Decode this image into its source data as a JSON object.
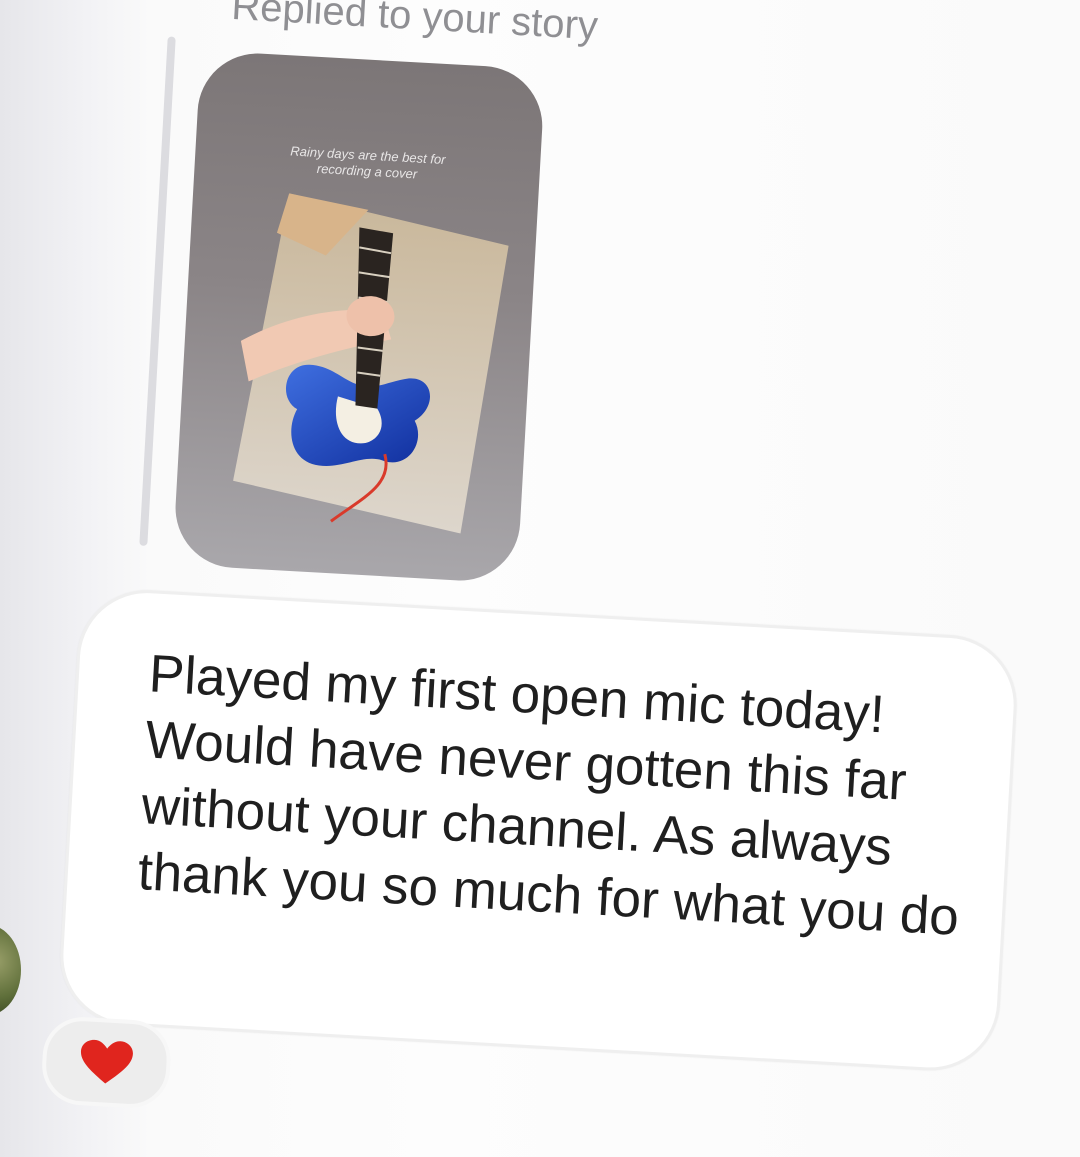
{
  "reply_label": "Replied to your story",
  "story": {
    "caption_line1": "Rainy days are the best for",
    "caption_line2": "recording a cover"
  },
  "message": {
    "text": "Played my first open mic today! Would have never gotten this far without your channel. As always thank you so much for what you do"
  },
  "reaction": {
    "emoji_name": "red-heart-icon",
    "color": "#e0251e"
  },
  "colors": {
    "bubble": "#ffffff",
    "label_gray": "#8f8f93",
    "reaction_bg": "#ededed",
    "story_bg": "#8b8587"
  }
}
